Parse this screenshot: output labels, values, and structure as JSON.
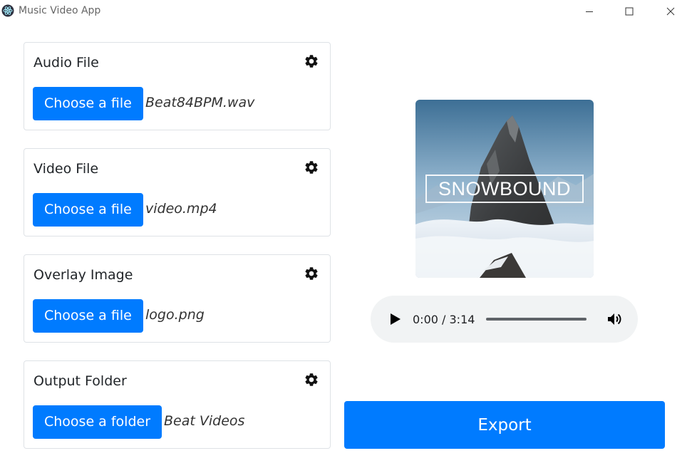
{
  "window": {
    "title": "Music Video App"
  },
  "cards": [
    {
      "title": "Audio File",
      "button": "Choose a file",
      "file": "Beat84BPM.wav"
    },
    {
      "title": "Video File",
      "button": "Choose a file",
      "file": "video.mp4"
    },
    {
      "title": "Overlay Image",
      "button": "Choose a file",
      "file": "logo.png"
    },
    {
      "title": "Output Folder",
      "button": "Choose a folder",
      "file": "Beat Videos"
    }
  ],
  "preview": {
    "overlay_text": "SNOWBOUND"
  },
  "player": {
    "time": "0:00 / 3:14",
    "progress": 0
  },
  "export": {
    "label": "Export"
  },
  "colors": {
    "primary": "#007bff",
    "player_bg": "#f1f3f4"
  },
  "icons": {
    "settings": "gear-icon",
    "play": "play-icon",
    "volume": "volume-icon"
  }
}
